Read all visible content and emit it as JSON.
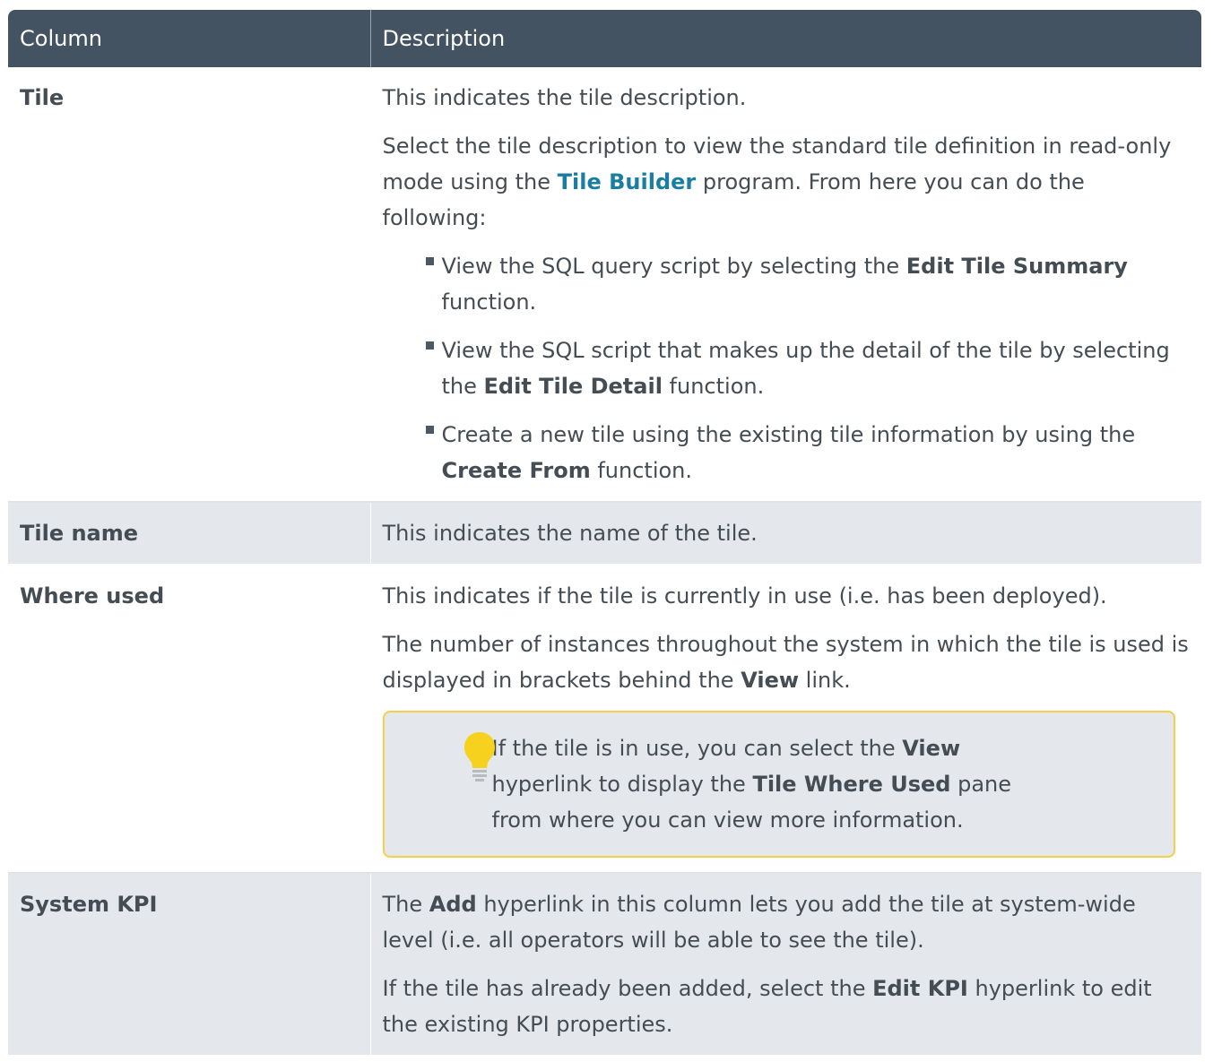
{
  "header": {
    "column": "Column",
    "description": "Description"
  },
  "rows": [
    {
      "name": "Tile",
      "p1": "This indicates the tile description.",
      "p2_a": "Select the tile description to view the standard tile definition in read-only mode using the ",
      "p2_link": "Tile Builder",
      "p2_b": " program. From here you can do the following:",
      "bullets": [
        {
          "a": "View the SQL query script by selecting the ",
          "b": "Edit Tile Summary",
          "c": " function."
        },
        {
          "a": "View the SQL script that makes up the detail of the tile by selecting the ",
          "b": "Edit Tile Detail",
          "c": " function."
        },
        {
          "a": "Create a new tile using the existing tile information by using the ",
          "b": "Create From",
          "c": " function."
        }
      ]
    },
    {
      "name": "Tile name",
      "p1": "This indicates the name of the tile."
    },
    {
      "name": "Where used",
      "p1": "This indicates if the tile is currently in use (i.e. has been deployed).",
      "p2_a": "The number of instances throughout the system in which the tile is used is displayed in brackets behind the ",
      "p2_b": "View",
      "p2_c": " link.",
      "tip": {
        "a": "If the tile is in use, you can select the ",
        "b": "View",
        "c": " hyperlink to display the ",
        "d": "Tile Where Used",
        "e": " pane from where you can view more information."
      }
    },
    {
      "name": "System KPI",
      "p1_a": "The ",
      "p1_b": "Add",
      "p1_c": " hyperlink in this column lets you add the tile at system-wide level (i.e. all operators will be able to see the tile).",
      "p2_a": "If the tile has already been added, select the ",
      "p2_b": "Edit KPI",
      "p2_c": " hyperlink to edit the existing KPI properties."
    }
  ],
  "icons": {
    "tip": "lightbulb-icon",
    "bullet": "square-bullet-icon"
  },
  "colors": {
    "header_bg": "#435362",
    "link": "#1a7ea2",
    "tip_border": "#f2d04b",
    "row_alt": "#e4e7eb"
  }
}
